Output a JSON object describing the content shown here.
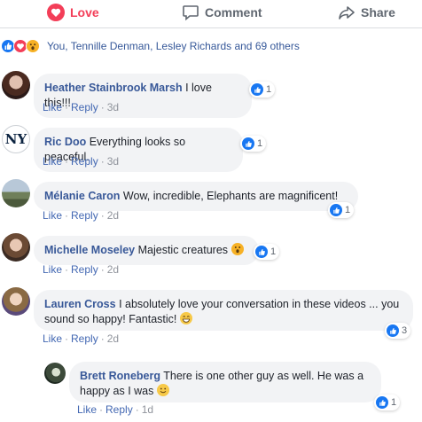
{
  "actions": {
    "love": "Love",
    "comment": "Comment",
    "share": "Share"
  },
  "summary": {
    "text": "You, Tennille Denman, Lesley Richards and 69 others",
    "reactions": [
      "like",
      "love",
      "wow"
    ]
  },
  "comments": [
    {
      "author": "Heather Stainbrook Marsh",
      "text": "I love this!!!",
      "like": "Like",
      "reply": "Reply",
      "time": "3d",
      "reactions": "1"
    },
    {
      "author": "Ric Doo",
      "text": "Everything looks so peaceful.",
      "like": "Like",
      "reply": "Reply",
      "time": "3d",
      "reactions": "1"
    },
    {
      "author": "Mélanie Caron",
      "text": "Wow, incredible, Elephants are magnificent!",
      "like": "Like",
      "reply": "Reply",
      "time": "2d",
      "reactions": "1"
    },
    {
      "author": "Michelle Moseley",
      "text": "Majestic creatures",
      "like": "Like",
      "reply": "Reply",
      "time": "2d",
      "reactions": "1"
    },
    {
      "author": "Lauren Cross",
      "text": "I absolutely love your conversation in these videos ... you sound so happy! Fantastic!",
      "like": "Like",
      "reply": "Reply",
      "time": "2d",
      "reactions": "3"
    },
    {
      "author": "Brett Roneberg",
      "text": "There is one other guy as well. He was a happy as I was",
      "like": "Like",
      "reply": "Reply",
      "time": "1d",
      "reactions": "1"
    }
  ],
  "colors": {
    "link": "#385898",
    "love": "#f33e58",
    "like": "#1877f2",
    "bubble": "#f2f3f5"
  }
}
